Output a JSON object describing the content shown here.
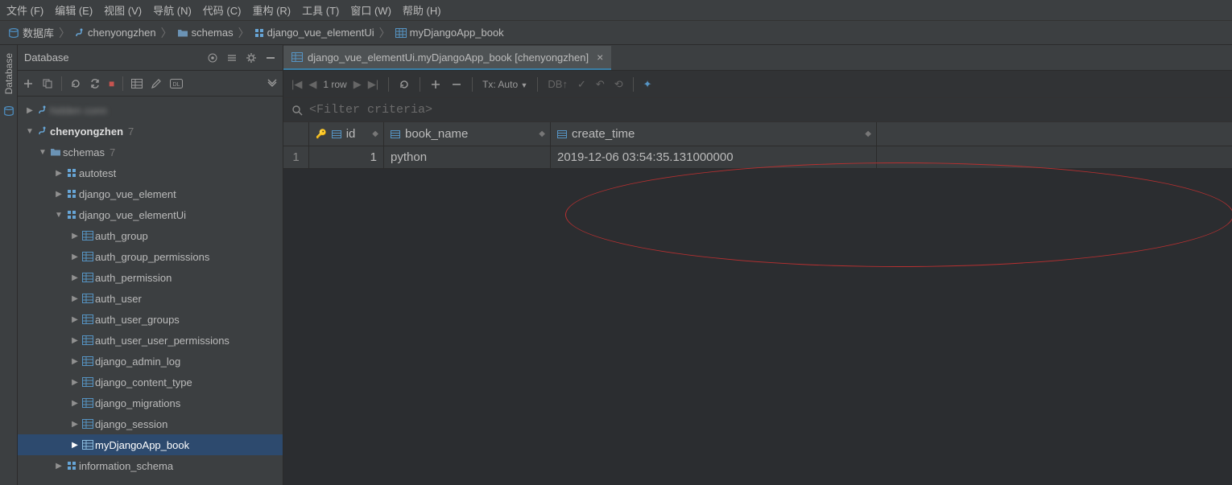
{
  "menu": {
    "file": "文件 (F)",
    "edit": "编辑 (E)",
    "view": "视图 (V)",
    "nav": "导航 (N)",
    "code": "代码 (C)",
    "refactor": "重构 (R)",
    "tools": "工具 (T)",
    "window": "窗口 (W)",
    "help": "帮助 (H)"
  },
  "breadcrumb": {
    "db": "数据库",
    "conn": "chenyongzhen",
    "schemas": "schemas",
    "schema": "django_vue_elementUi",
    "table": "myDjangoApp_book"
  },
  "sidetab": {
    "label": "Database"
  },
  "dbpanel": {
    "title": "Database"
  },
  "tree": {
    "conn": "chenyongzhen",
    "conn_count": "7",
    "schemas_label": "schemas",
    "schemas_count": "7",
    "schemas": [
      {
        "name": "autotest"
      },
      {
        "name": "django_vue_element"
      },
      {
        "name": "django_vue_elementUi"
      }
    ],
    "tables": [
      "auth_group",
      "auth_group_permissions",
      "auth_permission",
      "auth_user",
      "auth_user_groups",
      "auth_user_user_permissions",
      "django_admin_log",
      "django_content_type",
      "django_migrations",
      "django_session",
      "myDjangoApp_book"
    ],
    "info_schema": "information_schema"
  },
  "tab": {
    "title": "django_vue_elementUi.myDjangoApp_book [chenyongzhen]"
  },
  "datatoolbar": {
    "rowcount": "1 row",
    "tx": "Tx: Auto"
  },
  "filter": {
    "placeholder": "<Filter criteria>"
  },
  "grid": {
    "cols": {
      "id": "id",
      "book_name": "book_name",
      "create_time": "create_time"
    },
    "rows": [
      {
        "n": "1",
        "id": "1",
        "book_name": "python",
        "create_time": "2019-12-06 03:54:35.131000000"
      }
    ]
  }
}
